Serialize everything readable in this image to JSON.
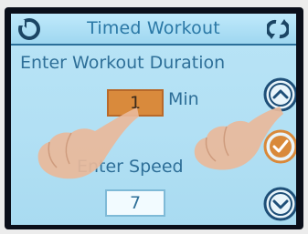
{
  "header": {
    "title": "Timed Workout",
    "back_icon": "back-circle-arrow-icon",
    "refresh_icon": "refresh-icon"
  },
  "duration": {
    "label": "Enter Workout Duration",
    "value": "1",
    "unit": "Min"
  },
  "speed": {
    "label": "Enter Speed",
    "value": "7"
  },
  "controls": {
    "up_icon": "chevron-up-icon",
    "confirm_icon": "checkmark-icon",
    "down_icon": "chevron-down-icon"
  },
  "colors": {
    "screen_bg": "#b2e0f4",
    "text_blue": "#2e6f98",
    "title_blue": "#2a78a6",
    "selected_field": "#d98a3c",
    "button_dark": "#1e4f78",
    "confirm_orange": "#d9893a"
  }
}
